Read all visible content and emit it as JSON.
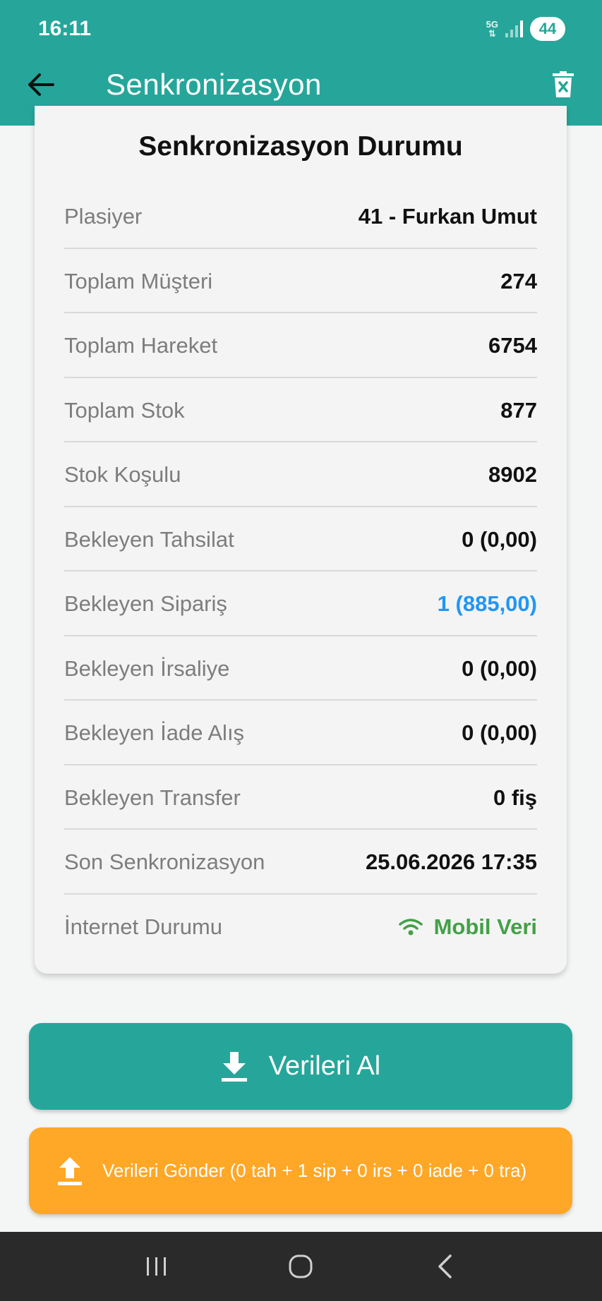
{
  "status_bar": {
    "time": "16:11",
    "network": "5G",
    "battery": "44"
  },
  "app_bar": {
    "title": "Senkronizasyon"
  },
  "card": {
    "title": "Senkronizasyon Durumu",
    "rows": [
      {
        "label": "Plasiyer",
        "value": "41 - Furkan Umut"
      },
      {
        "label": "Toplam Müşteri",
        "value": "274"
      },
      {
        "label": "Toplam Hareket",
        "value": "6754"
      },
      {
        "label": "Toplam Stok",
        "value": "877"
      },
      {
        "label": "Stok Koşulu",
        "value": "8902"
      },
      {
        "label": "Bekleyen Tahsilat",
        "value": "0 (0,00)"
      },
      {
        "label": "Bekleyen Sipariş",
        "value": "1 (885,00)"
      },
      {
        "label": "Bekleyen İrsaliye",
        "value": "0 (0,00)"
      },
      {
        "label": "Bekleyen İade Alış",
        "value": "0 (0,00)"
      },
      {
        "label": "Bekleyen Transfer",
        "value": "0 fiş"
      },
      {
        "label": "Son Senkronizasyon",
        "value": "25.06.2026 17:35"
      },
      {
        "label": "İnternet Durumu",
        "value": "Mobil Veri"
      }
    ]
  },
  "buttons": {
    "receive_label": "Verileri Al",
    "send_label": "Verileri Gönder (0 tah + 1 sip + 0 irs + 0 iade + 0 tra)"
  },
  "colors": {
    "primary": "#26a69a",
    "accent_orange": "#ffa726",
    "pending_blue": "#2196f3",
    "online_green": "#43a047"
  },
  "icons": {
    "back": "arrow-left-icon",
    "delete": "delete-icon",
    "wifi": "wifi-icon",
    "download": "download-icon",
    "upload": "upload-icon"
  }
}
